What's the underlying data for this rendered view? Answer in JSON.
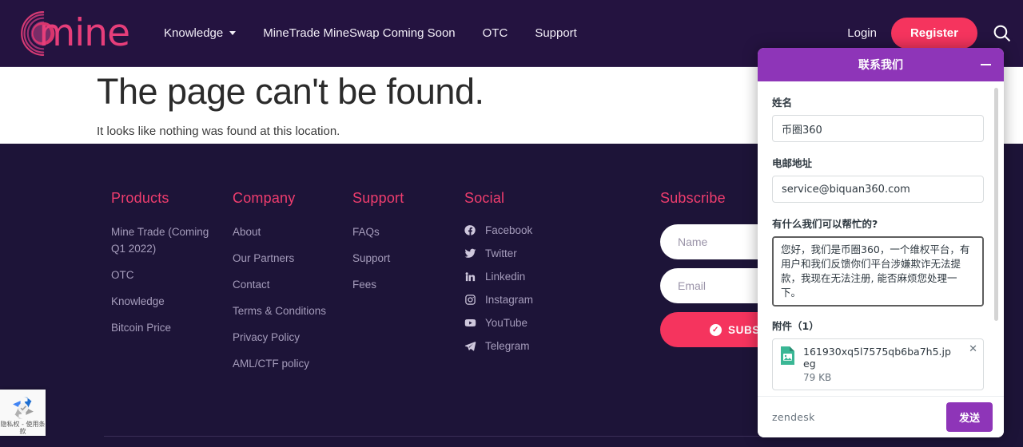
{
  "header": {
    "logo_text": "mine",
    "nav": [
      {
        "label": "Knowledge",
        "has_caret": true
      },
      {
        "label": "MineTrade MineSwap Coming Soon",
        "has_caret": false
      },
      {
        "label": "OTC",
        "has_caret": false
      },
      {
        "label": "Support",
        "has_caret": false
      }
    ],
    "login_label": "Login",
    "register_label": "Register",
    "search_icon": "search-icon",
    "bg_color": "#241340",
    "accent_color": "#f5345e"
  },
  "main": {
    "title": "The page can't be found.",
    "subtitle": "It looks like nothing was found at this location."
  },
  "footer": {
    "bg_color": "#1d1438",
    "heading_color": "#ef3d6e",
    "columns": [
      {
        "heading": "Products",
        "links": [
          "Mine Trade (Coming Q1 2022)",
          "OTC",
          "Knowledge",
          "Bitcoin Price"
        ]
      },
      {
        "heading": "Company",
        "links": [
          "About",
          "Our Partners",
          "Contact",
          "Terms & Conditions",
          "Privacy Policy",
          "AML/CTF policy"
        ]
      },
      {
        "heading": "Support",
        "links": [
          "FAQs",
          "Support",
          "Fees"
        ]
      }
    ],
    "social": {
      "heading": "Social",
      "items": [
        {
          "label": "Facebook",
          "icon": "facebook-icon"
        },
        {
          "label": "Twitter",
          "icon": "twitter-icon"
        },
        {
          "label": "Linkedin",
          "icon": "linkedin-icon"
        },
        {
          "label": "Instagram",
          "icon": "instagram-icon"
        },
        {
          "label": "YouTube",
          "icon": "youtube-icon"
        },
        {
          "label": "Telegram",
          "icon": "telegram-icon"
        }
      ]
    },
    "subscribe": {
      "heading": "Subscribe",
      "name_placeholder": "Name",
      "email_placeholder": "Email",
      "button_label": "SUBSCRIBE",
      "button_icon": "check-circle-icon"
    }
  },
  "recaptcha": {
    "icon": "recaptcha-icon",
    "privacy_label": "隐私权",
    "separator": "-",
    "terms_label": "使用条款"
  },
  "chat_widget": {
    "title": "联系我们",
    "minimize_icon": "minimize-icon",
    "name_label": "姓名",
    "name_value": "币圈360",
    "email_label": "电邮地址",
    "email_value": "service@biquan360.com",
    "message_label": "有什么我们可以帮忙的?",
    "message_value": "您好，我们是币圈360，一个维权平台，有用户和我们反馈你们平台涉嫌欺诈无法提款，我现在无法注册, 能否麻烦您处理一下。",
    "attachments_label": "附件（1）",
    "attachment": {
      "file_icon": "image-file-icon",
      "filename": "161930xq5l7575qb6ba7h5.jpeg",
      "filesize": "79 KB",
      "remove_icon": "close-icon"
    },
    "brand": "zendesk",
    "send_label": "发送",
    "header_color": "#8e35b8"
  }
}
